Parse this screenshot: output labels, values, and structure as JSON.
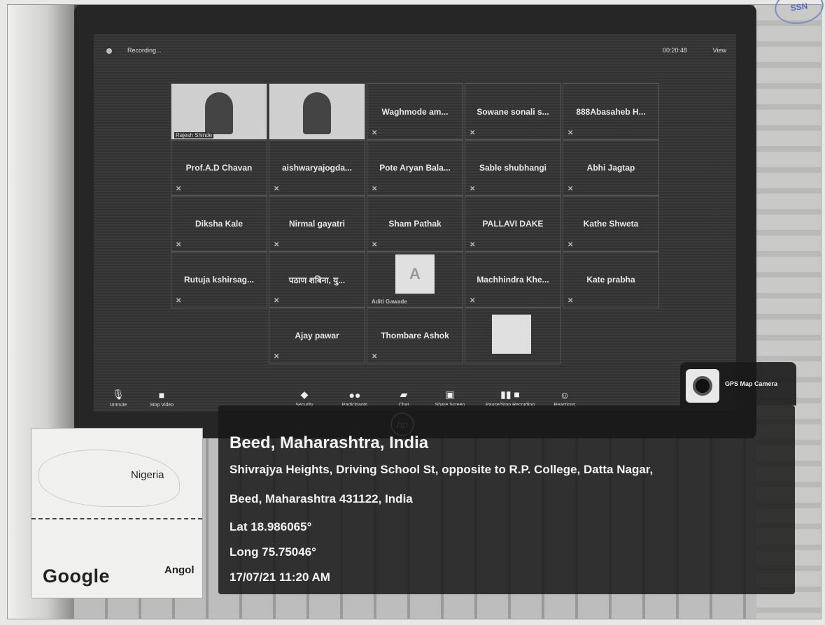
{
  "meeting": {
    "recording_label": "Recording...",
    "timer": "00:20:48",
    "view_label": "View",
    "video_tiles": [
      {
        "caption": "Rajesh Shinde"
      },
      {
        "caption": ""
      }
    ],
    "participants": [
      "Waghmode am...",
      "Sowane sonali s...",
      "888Abasaheb H...",
      "Prof.A.D Chavan",
      "aishwaryajogda...",
      "Pote Aryan Bala...",
      "Sable shubhangi",
      "Abhi Jagtap",
      "Diksha Kale",
      "Nirmal gayatri",
      "Sham Pathak",
      "PALLAVI DAKE",
      "Kathe Shweta",
      "Rutuja kshirsag...",
      "पठाण शबिना, यु...",
      "Machhindra Khe...",
      "Kate prabha",
      "Ajay pawar",
      "Thombare Ashok"
    ],
    "avatar_tile": {
      "letter": "A",
      "caption": "Aditi Gawade"
    },
    "toolbar": [
      {
        "label": "Unmute",
        "icon": "microphone-icon"
      },
      {
        "label": "Stop Video",
        "icon": "video-camera-icon"
      },
      {
        "label": "Security",
        "icon": "shield-icon"
      },
      {
        "label": "Participants",
        "icon": "participants-icon"
      },
      {
        "label": "Chat",
        "icon": "chat-icon"
      },
      {
        "label": "Share Screen",
        "icon": "share-screen-icon"
      },
      {
        "label": "Pause/Stop Recording",
        "icon": "recording-icon"
      },
      {
        "label": "Reactions",
        "icon": "reactions-icon"
      }
    ]
  },
  "laptop_brand": "hp",
  "map": {
    "label_nigeria": "Nigeria",
    "label_angola": "Angol",
    "logo": "Google"
  },
  "gps": {
    "app_name": "GPS Map Camera",
    "city": "Beed, Maharashtra, India",
    "address_line1": "Shivrajya Heights, Driving School St, opposite to R.P. College, Datta Nagar,",
    "address_line2": "Beed, Maharashtra 431122, India",
    "lat": "Lat 18.986065°",
    "long": "Long 75.75046°",
    "datetime": "17/07/21 11:20 AM"
  },
  "stamp_text": "SSN"
}
